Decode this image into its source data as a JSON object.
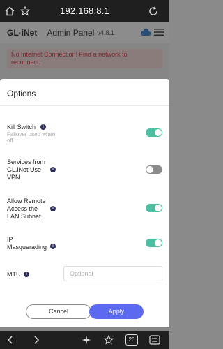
{
  "browser": {
    "url": "192.168.8.1",
    "tab_count": "20"
  },
  "app": {
    "logo": "GL·iNet",
    "title": "Admin Panel",
    "version": "v4.8.1",
    "alert": "No Internet Connection! Find a network to reconnect."
  },
  "modal": {
    "title": "Options",
    "options": [
      {
        "label_lines": [
          "Kill Switch"
        ],
        "sub": "Failover used when off",
        "enabled": true
      },
      {
        "label_lines": [
          "Services from",
          "GL.iNet Use",
          "VPN"
        ],
        "sub": "",
        "enabled": false
      },
      {
        "label_lines": [
          "Allow Remote",
          "Access the",
          "LAN Subnet"
        ],
        "sub": "",
        "enabled": true
      },
      {
        "label_lines": [
          "IP",
          "Masquerading"
        ],
        "sub": "",
        "enabled": true
      }
    ],
    "mtu_label": "MTU",
    "mtu_placeholder": "Optional",
    "cancel_label": "Cancel",
    "apply_label": "Apply"
  },
  "colors": {
    "toggle_on": "#4bbf9f",
    "toggle_off": "#8a8a8a",
    "primary": "#5b6af0",
    "alert_text": "#e04b5a"
  },
  "icons": [
    "home-icon",
    "star-outline-icon",
    "reload-icon",
    "cloud-icon",
    "menu-icon",
    "back-icon",
    "forward-icon",
    "extension-icon",
    "bookmark-icon",
    "tabs-icon",
    "browser-menu-icon"
  ]
}
